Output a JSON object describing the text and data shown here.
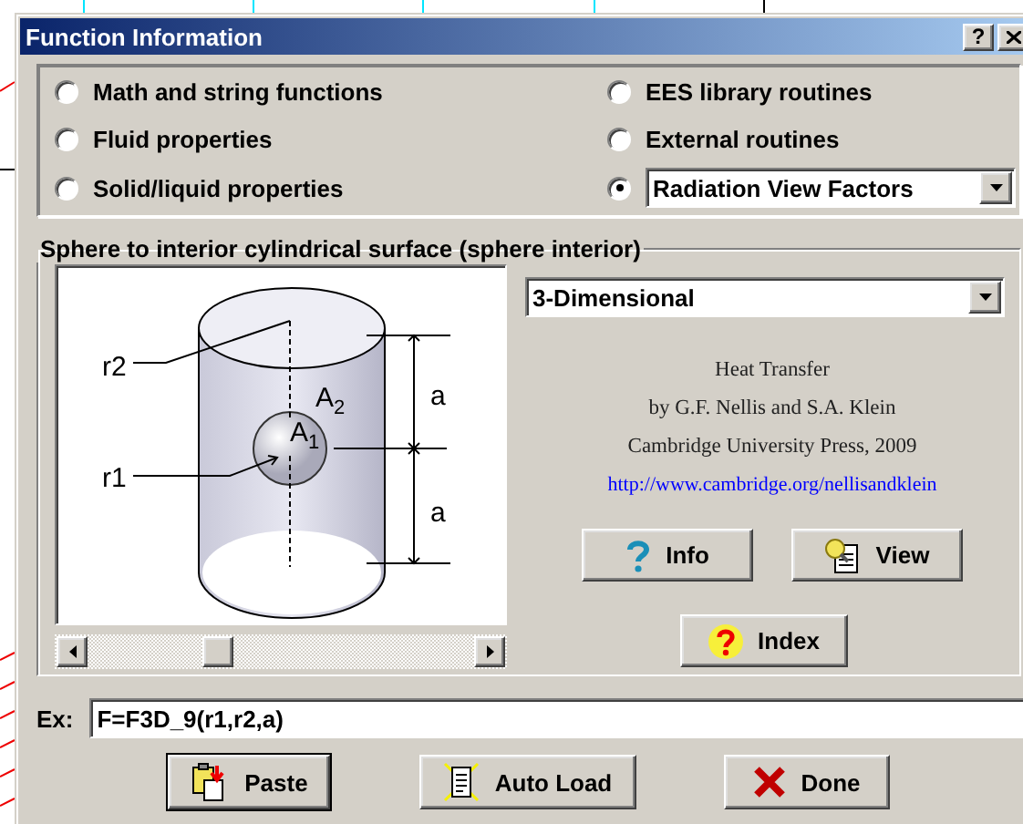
{
  "window": {
    "title": "Function Information",
    "help_button": "?"
  },
  "categories": [
    {
      "kind": "radio",
      "label": "Math and string functions",
      "selected": false
    },
    {
      "kind": "radio",
      "label": "EES library routines",
      "selected": false
    },
    {
      "kind": "radio",
      "label": "Fluid properties",
      "selected": false
    },
    {
      "kind": "radio",
      "label": "External routines",
      "selected": false
    },
    {
      "kind": "radio",
      "label": "Solid/liquid properties",
      "selected": false
    },
    {
      "kind": "dropdown",
      "label": "Radiation View Factors",
      "selected": true
    }
  ],
  "function_group": {
    "title": "Sphere to interior cylindrical surface (sphere interior)",
    "figure_labels": {
      "r2": "r2",
      "r1": "r1",
      "a_top": "a",
      "a_bottom": "a",
      "a2": "A$_{2}$",
      "a1": "A$_{1}$"
    },
    "view_select": "3-Dimensional",
    "reference": {
      "title": "Heat Transfer",
      "authors": "by G.F. Nellis and S.A. Klein",
      "publisher": "Cambridge University Press, 2009",
      "link": "http://www.cambridge.org/nellisandklein"
    },
    "buttons": [
      {
        "kind": "info",
        "label": "Info"
      },
      {
        "kind": "view",
        "label": "View"
      },
      {
        "kind": "index",
        "label": "Index"
      }
    ]
  },
  "example": {
    "label": "Ex:",
    "value": "F=F3D_9(r1,r2,a)"
  },
  "actions": [
    {
      "kind": "paste",
      "label": "Paste",
      "default": true
    },
    {
      "kind": "autoload",
      "label": "Auto Load",
      "default": false
    },
    {
      "kind": "done",
      "label": "Done",
      "default": false
    }
  ]
}
